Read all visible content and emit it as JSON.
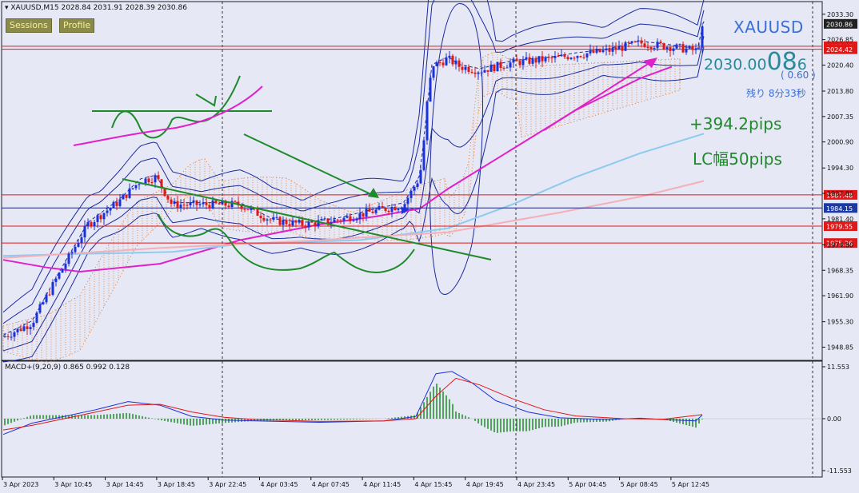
{
  "header": {
    "symbol_tf": "XAUUSD,M15",
    "ohlc": "2028.84 2031.91 2028.39 2030.86",
    "sessions_label": "Sessions",
    "profile_label": "Profile"
  },
  "quote": {
    "symbol": "XAUUSD",
    "price_main": "2030.00",
    "price_big": "08",
    "price_small": "6",
    "change": "( 0.60 )",
    "remaining": "残り 8分33秒"
  },
  "annotations": {
    "pips": "+394.2pips",
    "lc": "LC幅50pips"
  },
  "macd_label": "MACD+(9,20,9) 0.865 0.992 0.128",
  "colors": {
    "background": "#e6e8f5",
    "bull": "#1a32d8",
    "bear": "#e01818",
    "hline": "#e01818",
    "ma_magenta": "#e020c8",
    "ma_lightblue": "#8ccaf0",
    "ma_pink": "#f4b0b8",
    "trendline": "#1e8a2a",
    "macd_main": "#1a32d8",
    "macd_signal": "#e01818",
    "macd_hist": "#1e8a2a",
    "ichimoku": "#e07a30"
  },
  "chart_data": {
    "type": "candlestick",
    "symbol": "XAUUSD",
    "timeframe": "M15",
    "ylim": [
      1945.5,
      2036.5
    ],
    "y_ticks": [
      2033.3,
      2026.85,
      2020.4,
      2013.8,
      2007.35,
      2000.9,
      1994.3,
      1987.85,
      1981.4,
      1974.8,
      1968.35,
      1961.9,
      1955.3,
      1948.85
    ],
    "x_labels": [
      "3 Apr 2023",
      "3 Apr 10:45",
      "3 Apr 14:45",
      "3 Apr 18:45",
      "3 Apr 22:45",
      "4 Apr 03:45",
      "4 Apr 07:45",
      "4 Apr 11:45",
      "4 Apr 15:45",
      "4 Apr 19:45",
      "4 Apr 23:45",
      "5 Apr 04:45",
      "5 Apr 08:45",
      "5 Apr 12:45"
    ],
    "horizontal_lines": [
      {
        "label": "2030.86",
        "value": 2030.86,
        "style": "current"
      },
      {
        "label": "2025.17",
        "value": 2025.17,
        "style": "red"
      },
      {
        "label": "2024.42",
        "value": 2024.42,
        "style": "red"
      },
      {
        "label": "1987.48",
        "value": 1987.48,
        "style": "red"
      },
      {
        "label": "1984.15",
        "value": 1984.15,
        "style": "navy"
      },
      {
        "label": "1979.55",
        "value": 1979.55,
        "style": "red"
      },
      {
        "label": "1975.26",
        "value": 1975.26,
        "style": "red"
      }
    ],
    "price_path": [
      [
        0,
        1951
      ],
      [
        40,
        1955
      ],
      [
        70,
        1966
      ],
      [
        110,
        1980
      ],
      [
        150,
        1986
      ],
      [
        175,
        1991
      ],
      [
        195,
        1992
      ],
      [
        215,
        1985
      ],
      [
        250,
        1985
      ],
      [
        300,
        1985
      ],
      [
        340,
        1981
      ],
      [
        380,
        1980
      ],
      [
        420,
        1981
      ],
      [
        460,
        1983
      ],
      [
        505,
        1985
      ],
      [
        525,
        1992
      ],
      [
        540,
        2020
      ],
      [
        560,
        2022
      ],
      [
        575,
        2020
      ],
      [
        600,
        2019
      ],
      [
        640,
        2021
      ],
      [
        690,
        2022
      ],
      [
        720,
        2023
      ],
      [
        760,
        2024
      ],
      [
        800,
        2026
      ],
      [
        840,
        2025
      ],
      [
        872,
        2024
      ],
      [
        880,
        2031
      ]
    ],
    "macd": {
      "label": "MACD+(9,20,9)",
      "main": 0.865,
      "signal": 0.992,
      "histogram": 0.128,
      "ylim": [
        -11.553,
        11.553
      ],
      "y_ticks": [
        11.553,
        0.0,
        -11.553
      ]
    }
  }
}
